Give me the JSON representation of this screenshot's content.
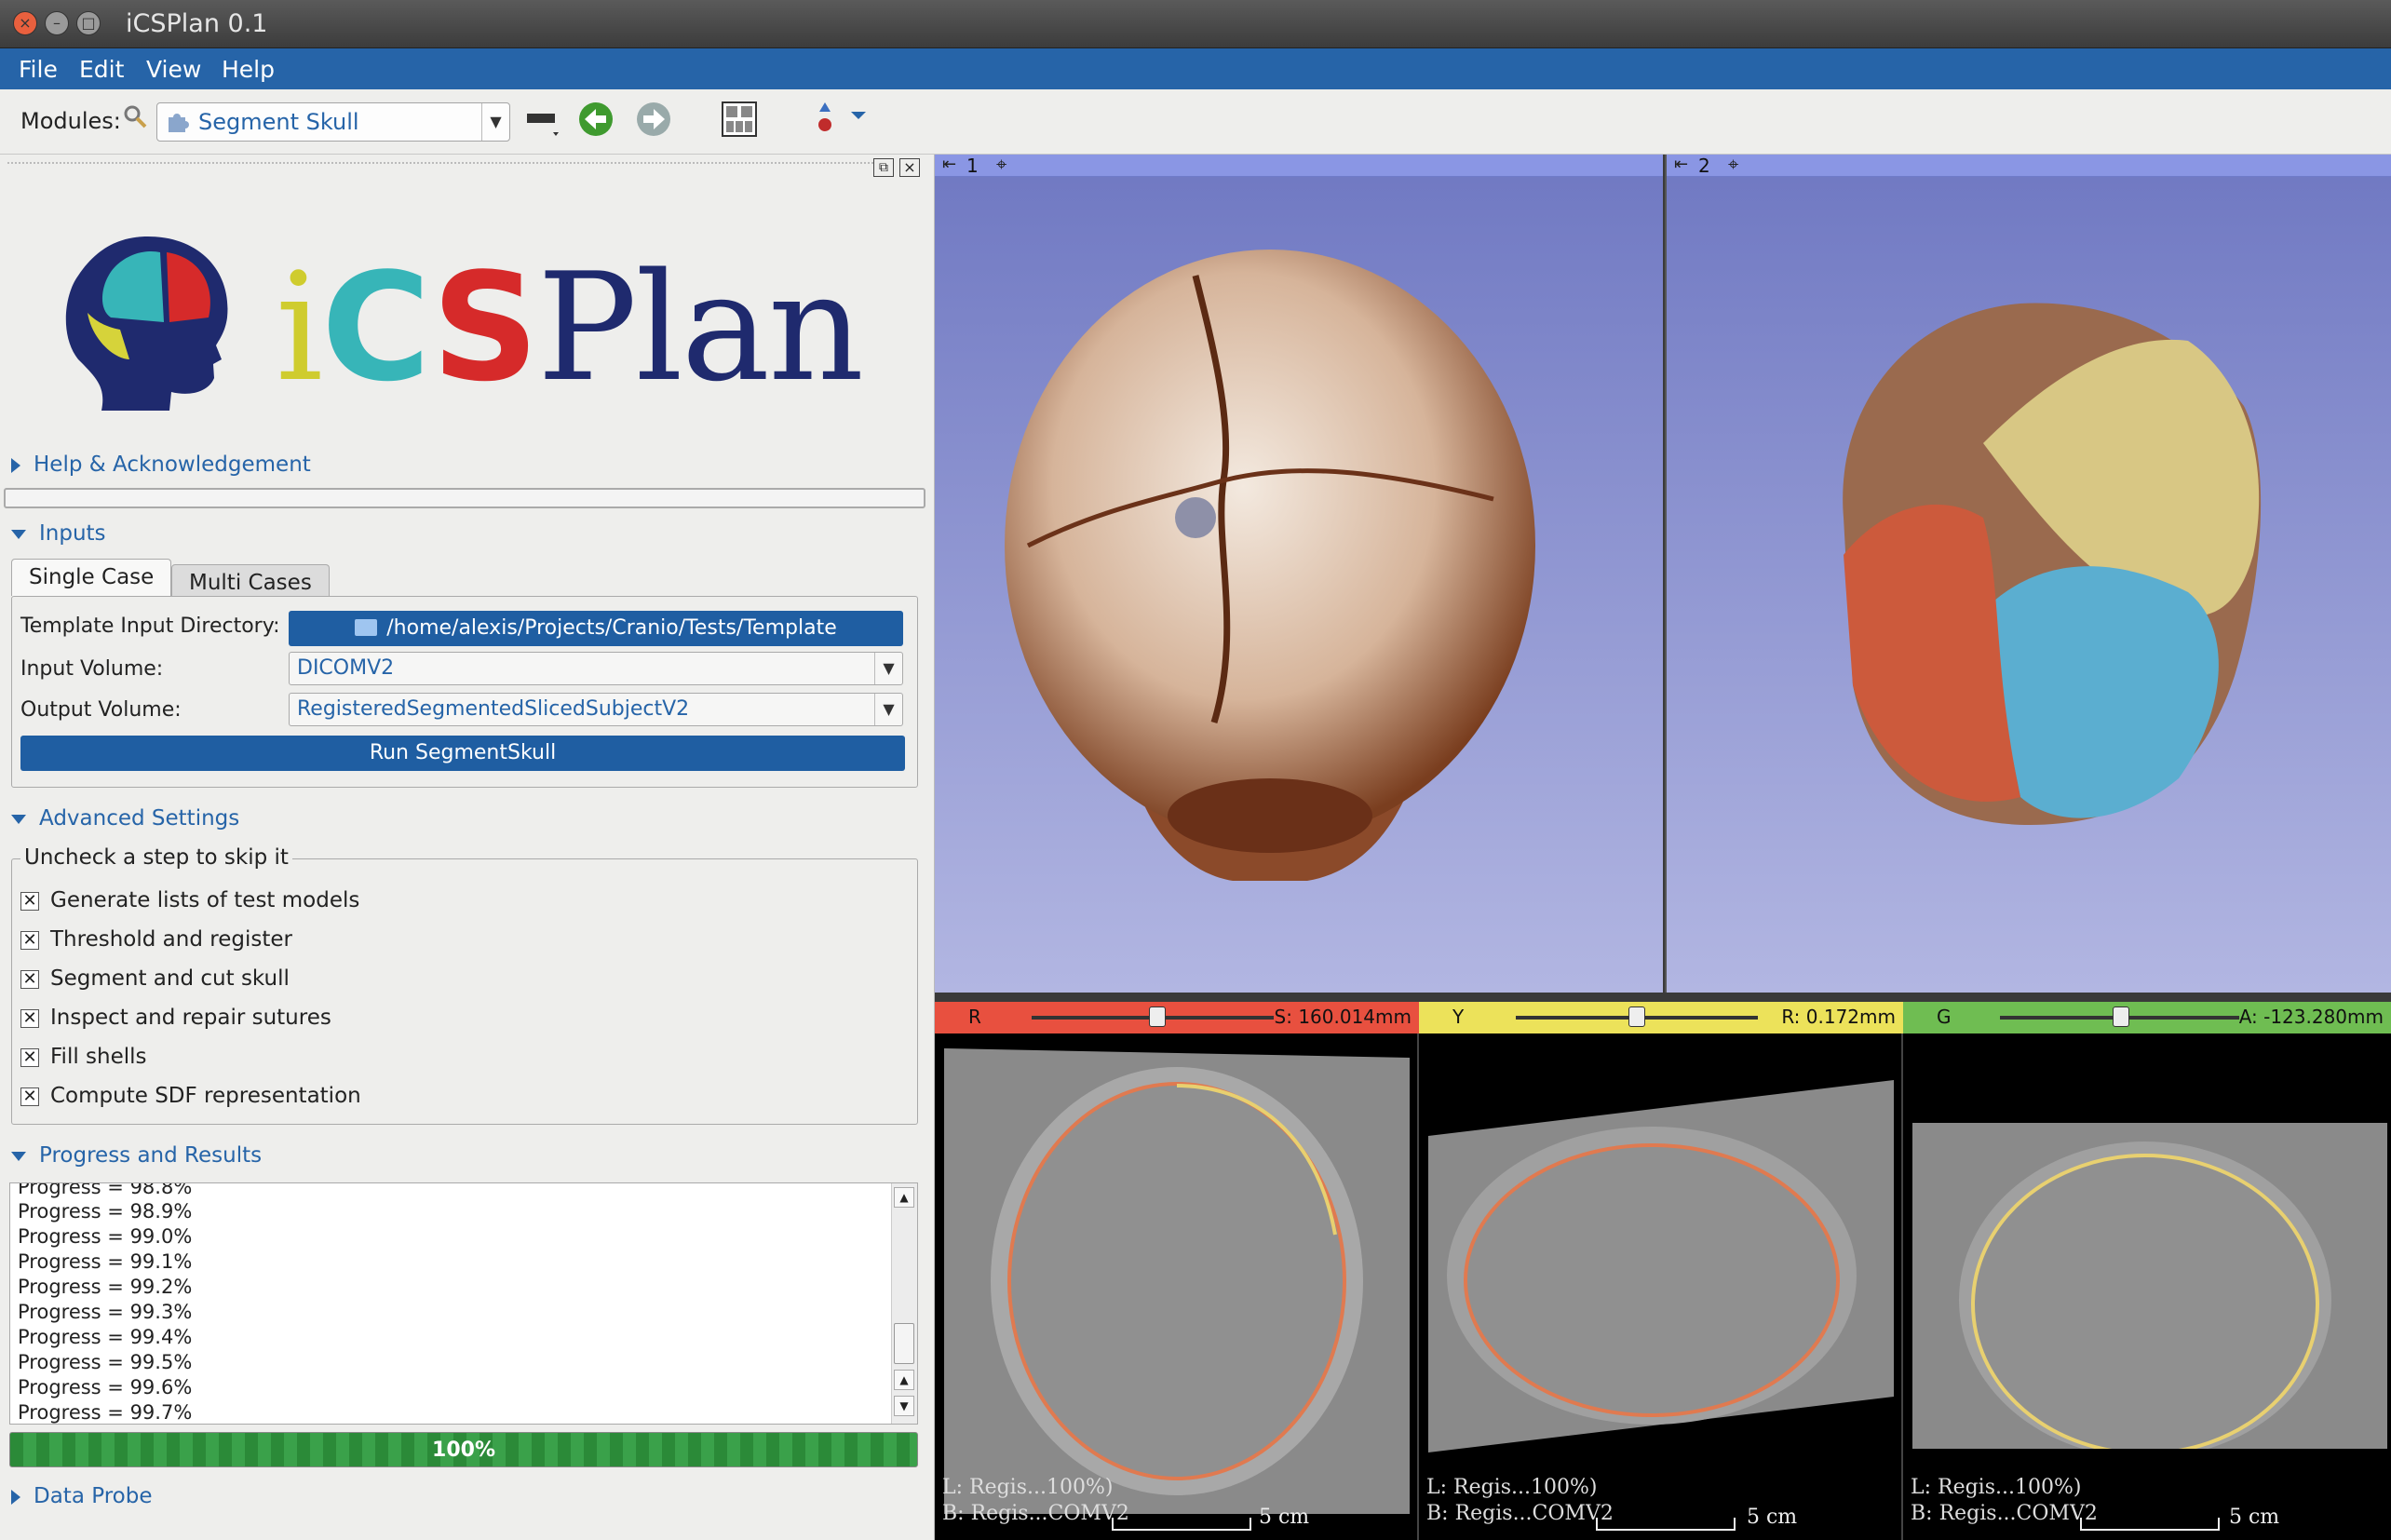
{
  "window": {
    "title": "iCSPlan 0.1",
    "close": "×",
    "minimize": "–",
    "maximize": "□"
  },
  "menu": [
    "File",
    "Edit",
    "View",
    "Help"
  ],
  "toolbar": {
    "modules_label": "Modules:",
    "module_selected": "Segment Skull"
  },
  "logo": {
    "text_i": "i",
    "text_c": "C",
    "text_s": "S",
    "text_plan": "Plan"
  },
  "sections": {
    "help": "Help & Acknowledgement",
    "inputs": "Inputs",
    "advanced": "Advanced Settings",
    "progress": "Progress and Results",
    "probe": "Data Probe"
  },
  "tabs": [
    "Single Case",
    "Multi Cases"
  ],
  "form": {
    "template_label": "Template Input Directory:",
    "template_value": "/home/alexis/Projects/Cranio/Tests/Template",
    "input_label": "Input Volume:",
    "input_value": "DICOMV2",
    "output_label": "Output Volume:",
    "output_value": "RegisteredSegmentedSlicedSubjectV2",
    "run_button": "Run SegmentSkull"
  },
  "advanced": {
    "legend": "Uncheck a step to skip it",
    "steps": [
      "Generate lists of test models",
      "Threshold and register",
      "Segment and cut skull",
      "Inspect and repair sutures",
      "Fill shells",
      "Compute SDF representation"
    ]
  },
  "log": [
    "Progress = 98.8%",
    "Progress = 98.9%",
    "Progress = 99.0%",
    "Progress = 99.1%",
    "Progress = 99.2%",
    "Progress = 99.3%",
    "Progress = 99.4%",
    "Progress = 99.5%",
    "Progress = 99.6%",
    "Progress = 99.7%"
  ],
  "progress_bar": {
    "value": 1.0,
    "label": "100%"
  },
  "views": {
    "v1": {
      "num": "1"
    },
    "v2": {
      "num": "2"
    },
    "red": {
      "letter": "R",
      "value": "S: 160.014mm",
      "slider": 0.52,
      "color": "#e8503f",
      "corner1": "L: Regis...100%)",
      "corner2": "B: Regis...COMV2",
      "scale": "5 cm"
    },
    "yellow": {
      "letter": "Y",
      "value": "R: 0.172mm",
      "slider": 0.5,
      "color": "#ece25a",
      "corner1": "L: Regis...100%)",
      "corner2": "B: Regis...COMV2",
      "scale": "5 cm"
    },
    "green": {
      "letter": "G",
      "value": "A: -123.280mm",
      "slider": 0.5,
      "color": "#6fbd52",
      "corner1": "L: Regis...100%)",
      "corner2": "B: Regis...COMV2",
      "scale": "5 cm"
    }
  }
}
